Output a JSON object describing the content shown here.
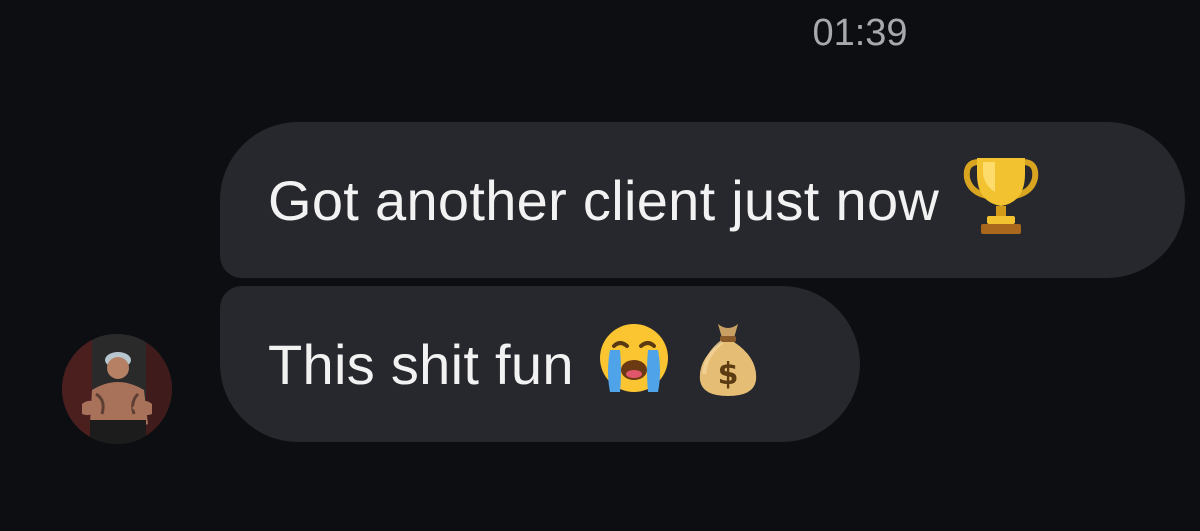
{
  "conversation": {
    "timestamp": "01:39",
    "messages": [
      {
        "text": "Got another client just now",
        "emoji_icons": [
          "trophy-icon"
        ]
      },
      {
        "text": "This shit fun",
        "emoji_icons": [
          "crying-face-icon",
          "money-bag-icon"
        ]
      }
    ],
    "sender": {
      "avatar_icon": "avatar"
    }
  },
  "colors": {
    "background": "#0c0e11",
    "bubble": "#26282d",
    "text": "#f2f2f2",
    "timestamp": "#a7a9ad"
  }
}
